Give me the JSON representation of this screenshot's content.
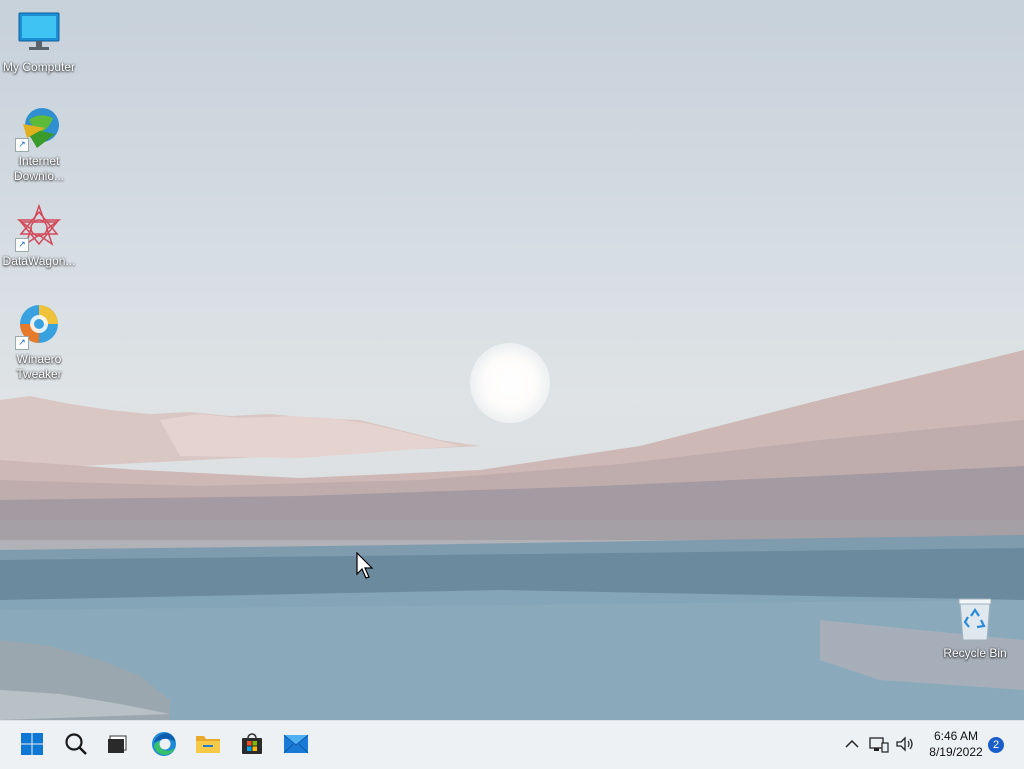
{
  "desktop": {
    "icons": [
      {
        "label": "My Computer",
        "icon": "monitor-icon"
      },
      {
        "label": "Internet Downlo...",
        "line1": "Internet",
        "line2": "Downlo...",
        "icon": "internet-download-manager-icon",
        "shortcut": true
      },
      {
        "label": "DataWagon...",
        "icon": "datawagon-icon",
        "shortcut": true
      },
      {
        "label": "Winaero Tweaker",
        "line1": "Winaero",
        "line2": "Tweaker",
        "icon": "winaero-tweaker-icon",
        "shortcut": true
      },
      {
        "label": "Recycle Bin",
        "icon": "recycle-bin-icon"
      }
    ]
  },
  "taskbar": {
    "pinned": [
      {
        "name": "start",
        "icon": "windows-logo-icon"
      },
      {
        "name": "search",
        "icon": "search-icon"
      },
      {
        "name": "task-view",
        "icon": "task-view-icon"
      },
      {
        "name": "edge",
        "icon": "edge-icon"
      },
      {
        "name": "file-explorer",
        "icon": "folder-icon"
      },
      {
        "name": "store",
        "icon": "store-icon"
      },
      {
        "name": "mail",
        "icon": "mail-icon"
      }
    ],
    "tray": {
      "time": "6:46 AM",
      "date": "8/19/2022",
      "notification_count": "2"
    }
  },
  "colors": {
    "accent": "#0f6cbd",
    "badge": "#1a5fc9",
    "taskbar": "#eef1f4"
  }
}
